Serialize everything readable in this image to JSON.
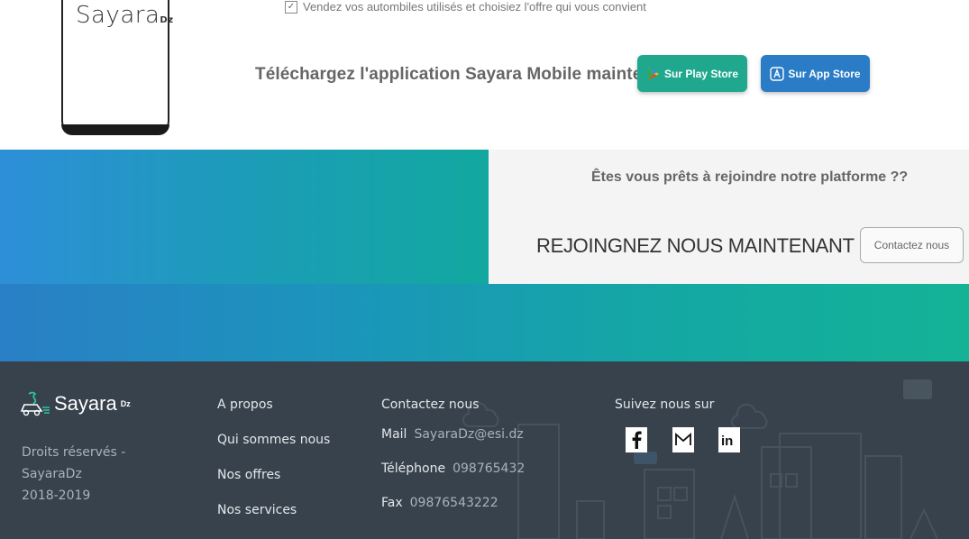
{
  "promo": {
    "phone_logo": "Sayara",
    "phone_logo_suffix": "Dz",
    "feature_line": "Vendez vos autombiles utilisés et choisiez l'offre qui vous convient",
    "download_text": "Téléchargez l'application Sayara Mobile maintenant !",
    "play_store_label": "Sur Play Store",
    "app_store_label": "Sur App Store"
  },
  "join": {
    "question": "Êtes vous prêts à rejoindre notre platforme ??",
    "title": "REJOINGNEZ NOUS MAINTENANT",
    "contact_button": "Contactez nous"
  },
  "footer": {
    "logo_text": "Sayara",
    "logo_suffix": "Dz",
    "rights_line1": "Droits réservés - SayaraDz",
    "rights_line2": "2018-2019",
    "links": [
      "A propos",
      "Qui sommes nous",
      "Nos offres",
      "Nos services"
    ],
    "contact_heading": "Contactez nous",
    "mail_label": "Mail",
    "mail_value": "SayaraDz@esi.dz",
    "phone_label": "Téléphone",
    "phone_value": "098765432",
    "fax_label": "Fax",
    "fax_value": "09876543222",
    "social_heading": "Suivez nous sur",
    "social": [
      "facebook-icon",
      "gmail-icon",
      "linkedin-icon"
    ]
  },
  "colors": {
    "play_store": "#20a88f",
    "app_store": "#2a7cc7",
    "footer_bg": "#37424d"
  }
}
